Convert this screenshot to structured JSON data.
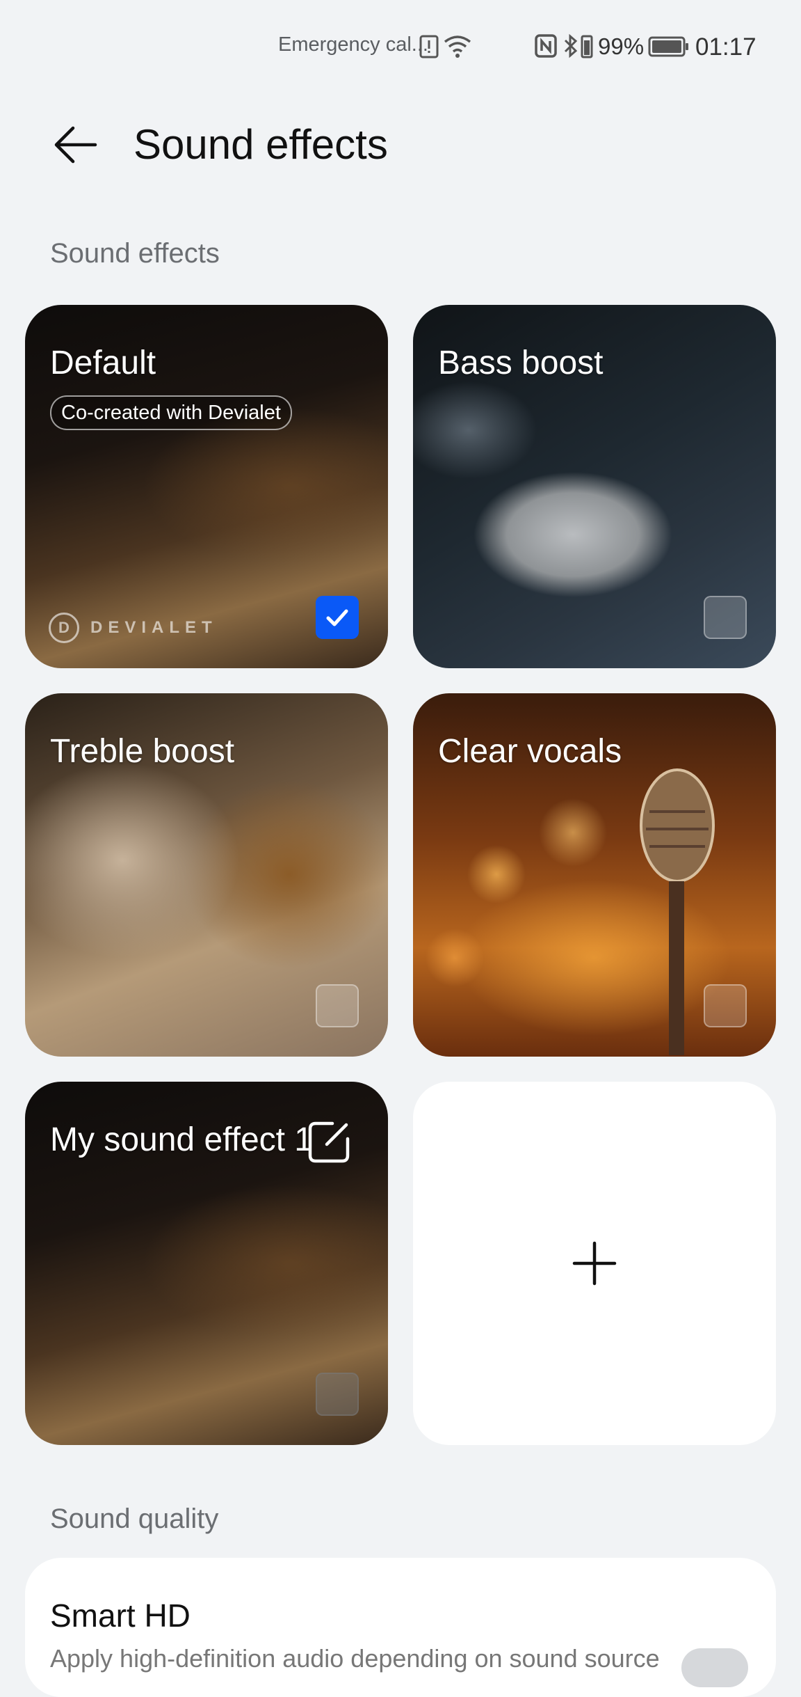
{
  "status_bar": {
    "carrier": "Emergency cal...",
    "battery_percent": "99%",
    "time": "01:17"
  },
  "header": {
    "title": "Sound effects"
  },
  "sections": {
    "effects_label": "Sound effects",
    "quality_label": "Sound quality"
  },
  "effects": {
    "default": {
      "title": "Default",
      "badge": "Co-created with Devialet",
      "brand": "DEVIALET",
      "selected": true
    },
    "bass": {
      "title": "Bass boost",
      "selected": false
    },
    "treble": {
      "title": "Treble boost",
      "selected": false
    },
    "vocals": {
      "title": "Clear vocals",
      "selected": false
    },
    "custom": {
      "title": "My sound effect 1",
      "selected": false
    }
  },
  "quality": {
    "smart_hd_title": "Smart HD",
    "smart_hd_desc": "Apply high-definition audio depending on sound source"
  },
  "colors": {
    "accent": "#0a59f7",
    "background": "#f1f3f5"
  }
}
